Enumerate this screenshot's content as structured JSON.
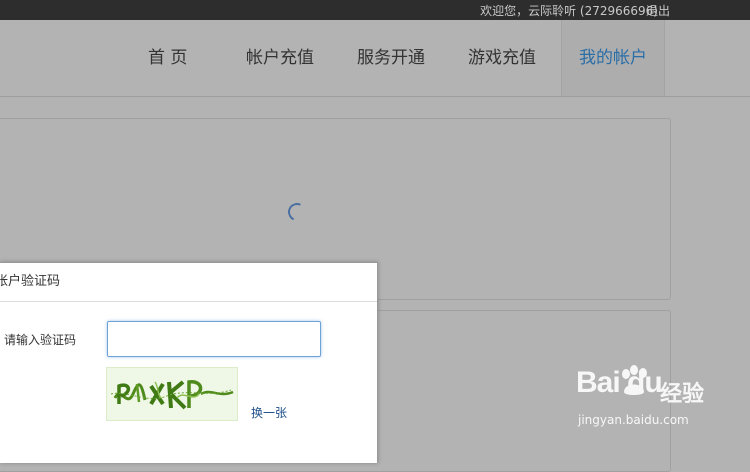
{
  "topbar": {
    "welcome_text": "欢迎您，云际聆听 (272966696)",
    "logout_label": "退出"
  },
  "nav": {
    "items": [
      {
        "label": "首 页"
      },
      {
        "label": "帐户充值"
      },
      {
        "label": "服务开通"
      },
      {
        "label": "游戏充值"
      },
      {
        "label": "我的帐户"
      }
    ],
    "active_color": "#2a6ea8"
  },
  "dialog": {
    "title": "帐户验证码",
    "captcha_label": "请输入验证码",
    "captcha_value": "",
    "refresh_label": "换一张"
  },
  "watermark": {
    "logo_text": "Bai du",
    "cn_text": "经验",
    "url": "jingyan.baidu.com"
  }
}
